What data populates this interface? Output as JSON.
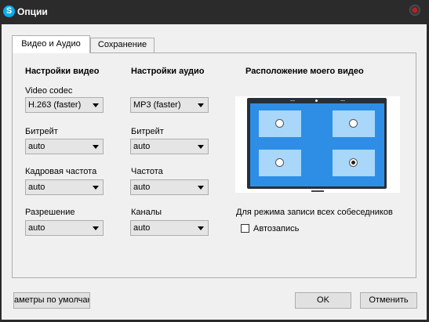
{
  "window": {
    "title": "Опции",
    "app_icon": "skype-icon",
    "close_icon": "close-icon"
  },
  "tabs": [
    {
      "label": "Видео и Аудио",
      "active": true
    },
    {
      "label": "Сохранение",
      "active": false
    }
  ],
  "video": {
    "heading": "Настройки видео",
    "codec_label": "Video codec",
    "codec_value": "H.263 (faster)",
    "bitrate_label": "Битрейт",
    "bitrate_value": "auto",
    "framerate_label": "Кадровая частота",
    "framerate_value": "auto",
    "resolution_label": "Разрешение",
    "resolution_value": "auto"
  },
  "audio": {
    "heading": "Настройки аудио",
    "codec_value": "MP3 (faster)",
    "bitrate_label": "Битрейт",
    "bitrate_value": "auto",
    "frequency_label": "Частота",
    "frequency_value": "auto",
    "channels_label": "Каналы",
    "channels_value": "auto"
  },
  "placement": {
    "heading": "Расположение моего видео",
    "selected_position": "bottom-right",
    "all_participants_label": "Для режима записи всех собеседников",
    "autorecord_label": "Автозапись",
    "autorecord_checked": false
  },
  "buttons": {
    "defaults_label": "аметры по умолчан",
    "ok_label": "OK",
    "cancel_label": "Отменить"
  },
  "colors": {
    "titlebar": "#2b2b2b",
    "screen": "#2e8ee6",
    "quadrant": "#a8d7f9"
  }
}
